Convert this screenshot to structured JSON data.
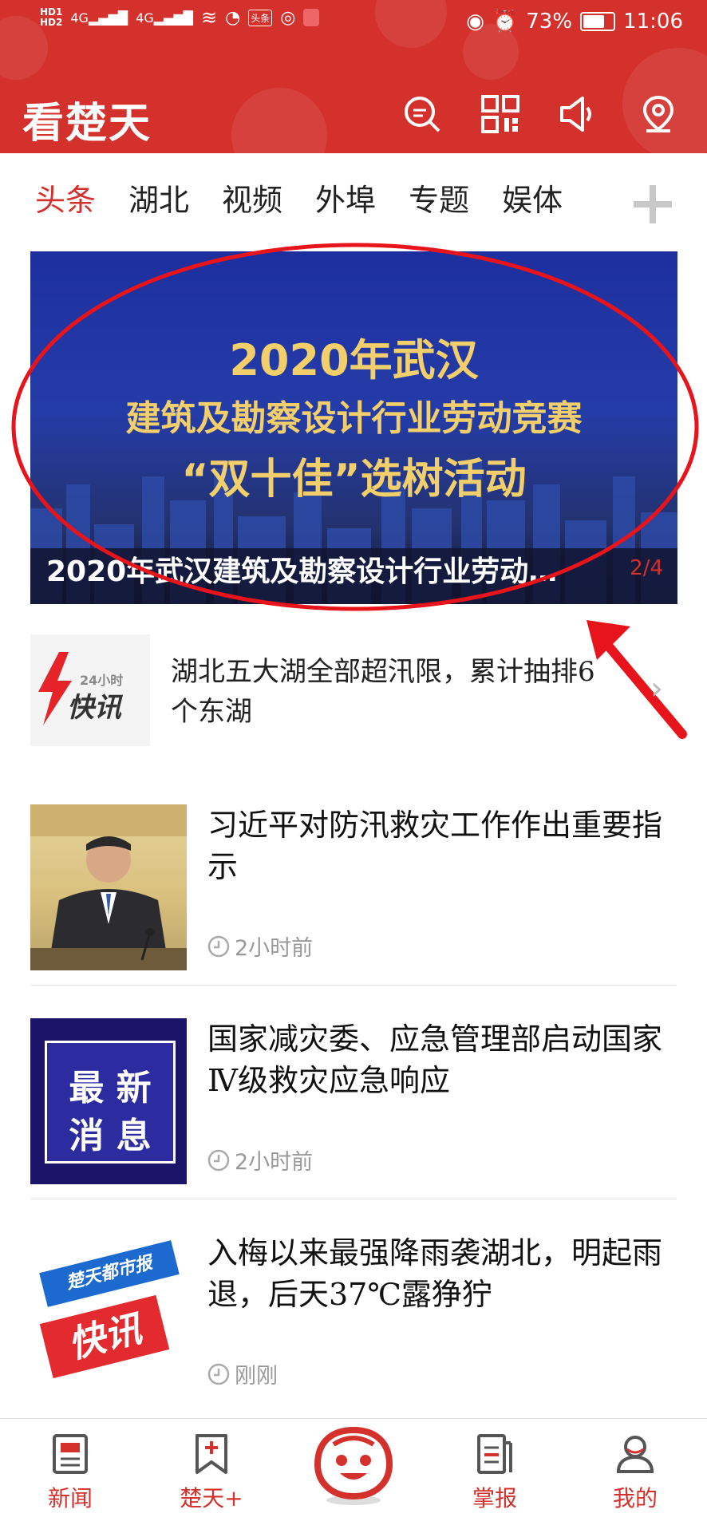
{
  "status_bar": {
    "battery": "73%",
    "time": "11:06",
    "hd_top": "HD1",
    "hd_bottom": "HD2",
    "signal1": "4G",
    "signal2": "4G",
    "app_badge": "头条"
  },
  "header": {
    "brand": "看楚天",
    "accent_color": "#d4312d",
    "icons": [
      "search-icon",
      "qr-scan-icon",
      "speaker-icon",
      "location-icon"
    ]
  },
  "tabs": [
    {
      "label": "头条",
      "active": true
    },
    {
      "label": "湖北"
    },
    {
      "label": "视频"
    },
    {
      "label": "外埠"
    },
    {
      "label": "专题"
    },
    {
      "label": "娱体"
    }
  ],
  "banner": {
    "line1": "2020年武汉",
    "line2": "建筑及勘察设计行业劳动竞赛",
    "line3": "“双十佳”选树活动",
    "caption": "2020年武汉建筑及勘察设计行业劳动…",
    "page": "2/4"
  },
  "flash": {
    "logo_small": "24小时",
    "logo_big": "快讯",
    "text": "湖北五大湖全部超汛限，累计抽排6个东湖"
  },
  "news": [
    {
      "title": "习近平对防汛救灾工作作出重要指示",
      "time": "2小时前"
    },
    {
      "title": "国家减灾委、应急管理部启动国家Ⅳ级救灾应急响应",
      "time": "2小时前",
      "thumb_line1": "最 新",
      "thumb_line2": "消 息"
    },
    {
      "title": "入梅以来最强降雨袭湖北，明起雨退，后天37℃露狰狞",
      "time": "刚刚",
      "thumb_small": "楚天都市报",
      "thumb_big": "快讯"
    }
  ],
  "bottom_nav": [
    {
      "label": "新闻"
    },
    {
      "label": "楚天+"
    },
    {
      "label": ""
    },
    {
      "label": "掌报"
    },
    {
      "label": "我的"
    }
  ]
}
